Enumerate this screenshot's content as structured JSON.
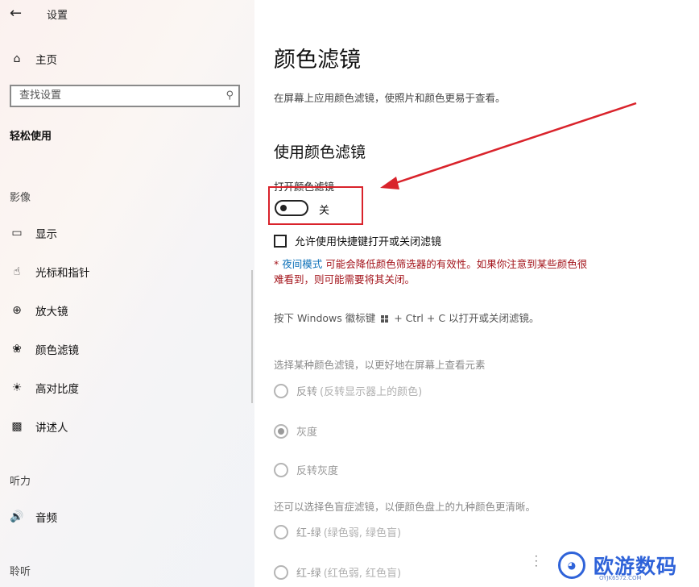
{
  "app": {
    "title": "设置",
    "back_icon": "back-arrow-icon"
  },
  "sidebar": {
    "home": "主页",
    "search_placeholder": "查找设置",
    "category": "轻松使用",
    "groups": [
      {
        "label": "影像",
        "items": [
          {
            "icon": "display-icon",
            "label": "显示"
          },
          {
            "icon": "cursor-icon",
            "label": "光标和指针"
          },
          {
            "icon": "magnifier-icon",
            "label": "放大镜"
          },
          {
            "icon": "palette-icon",
            "label": "颜色滤镜"
          },
          {
            "icon": "contrast-icon",
            "label": "高对比度"
          },
          {
            "icon": "narrator-icon",
            "label": "讲述人"
          }
        ]
      },
      {
        "label": "听力",
        "items": [
          {
            "icon": "audio-icon",
            "label": "音频"
          }
        ]
      },
      {
        "label": "聆听",
        "items": []
      }
    ]
  },
  "main": {
    "title": "颜色滤镜",
    "description": "在屏幕上应用颜色滤镜，使照片和颜色更易于查看。",
    "section_title": "使用颜色滤镜",
    "toggle_label": "打开颜色滤镜",
    "toggle_state": "关",
    "toggle_on": false,
    "checkbox_label": "允许使用快捷键打开或关闭滤镜",
    "checkbox_checked": false,
    "note_prefix": "* ",
    "note_link": "夜间模式",
    "note_rest_1": " 可能会降低颜色筛选器的有效性。如果你注意到某些颜色很",
    "note_rest_2": "难看到，则可能需要将其关闭。",
    "shortcut_before": "按下 Windows 徽标键",
    "shortcut_after": "+ Ctrl + C 以打开或关闭滤镜。",
    "choose_label": "选择某种颜色滤镜，以更好地在屏幕上查看元素",
    "filters": [
      {
        "label": "反转",
        "sub": "(反转显示器上的颜色)",
        "selected": false
      },
      {
        "label": "灰度",
        "sub": "",
        "selected": true
      },
      {
        "label": "反转灰度",
        "sub": "",
        "selected": false
      }
    ],
    "colorblind_label": "还可以选择色盲症滤镜，以便颜色盘上的九种颜色更清晰。",
    "colorblind_filters": [
      {
        "label": "红-绿",
        "sub": "(绿色弱, 绿色盲)",
        "selected": false
      },
      {
        "label": "红-绿",
        "sub": "(红色弱, 红色盲)",
        "selected": false
      }
    ]
  },
  "annotation": {
    "color": "#d9232b"
  },
  "watermark": {
    "text": "欧游数码",
    "sub": "OYJK6572.COM",
    "color": "#2f63d9"
  }
}
